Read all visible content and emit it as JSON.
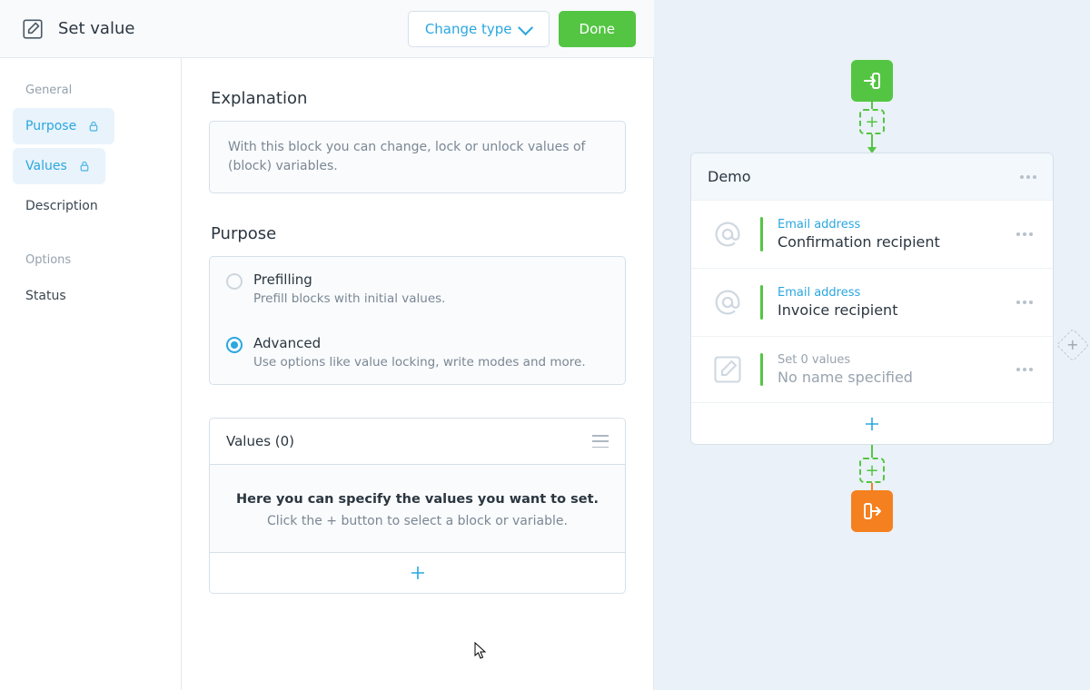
{
  "header": {
    "title": "Set value",
    "change_type_label": "Change type",
    "done_label": "Done"
  },
  "sidebar": {
    "group_general": "General",
    "group_options": "Options",
    "items": {
      "purpose": "Purpose",
      "values": "Values",
      "description": "Description",
      "status": "Status"
    }
  },
  "explanation": {
    "heading": "Explanation",
    "text": "With this block you can change, lock or unlock values of (block) variables."
  },
  "purpose": {
    "heading": "Purpose",
    "options": [
      {
        "title": "Prefilling",
        "desc": "Prefill blocks with initial values.",
        "checked": false
      },
      {
        "title": "Advanced",
        "desc": "Use options like value locking, write modes and more.",
        "checked": true
      }
    ]
  },
  "values_panel": {
    "heading": "Values (0)",
    "empty_title": "Here you can specify the values you want to set.",
    "empty_sub": "Click the + button to select a block or variable."
  },
  "canvas": {
    "card_title": "Demo",
    "rows": [
      {
        "small": "Email address",
        "big": "Confirmation recipient",
        "icon": "at",
        "small_gray": false,
        "big_muted": false
      },
      {
        "small": "Email address",
        "big": "Invoice recipient",
        "icon": "at",
        "small_gray": false,
        "big_muted": false
      },
      {
        "small": "Set 0 values",
        "big": "No name specified",
        "icon": "pencil",
        "small_gray": true,
        "big_muted": true
      }
    ]
  },
  "colors": {
    "blue": "#2aa7df",
    "green": "#54c543",
    "orange": "#f5801f"
  }
}
